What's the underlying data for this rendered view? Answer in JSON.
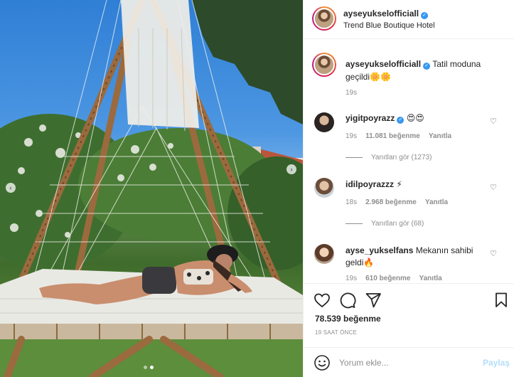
{
  "post": {
    "username": "ayseyukselofficiall",
    "location": "Trend Blue Boutique Hotel",
    "caption_username": "ayseyukselofficiall",
    "caption_text": "Tatil moduna geçildi🌼🌼",
    "caption_time": "19s",
    "likes": "78.539 beğenme",
    "time_ago": "19 SAAT ÖNCE",
    "carousel": {
      "slide_count": 2,
      "active_slide": 2
    }
  },
  "comments": [
    {
      "username": "yigitpoyrazz",
      "verified": true,
      "text": "😍😍",
      "time": "19s",
      "likes": "11.081 beğenme",
      "reply_label": "Yanıtla",
      "view_replies": "Yanıtları gör (1273)"
    },
    {
      "username": "idilpoyrazzz",
      "verified": false,
      "text": "⚡",
      "time": "18s",
      "likes": "2.968 beğenme",
      "reply_label": "Yanıtla",
      "view_replies": "Yanıtları gör (68)"
    },
    {
      "username": "ayse_yukselfans",
      "verified": false,
      "text": "Mekanın sahibi geldi🔥",
      "time": "19s",
      "likes": "610 beğenme",
      "reply_label": "Yanıtla"
    }
  ],
  "add_comment": {
    "placeholder": "Yorum ekle...",
    "post_label": "Paylaş"
  },
  "icons": {
    "like": "heart-icon",
    "comment": "comment-icon",
    "share": "share-icon",
    "save": "bookmark-icon",
    "emoji": "smiley-icon",
    "verified": "verified-badge-icon",
    "nav_prev": "chevron-left-icon",
    "nav_next": "chevron-right-icon"
  },
  "colors": {
    "verified": "#3897f0",
    "post_button_disabled": "#b2dffc",
    "muted_text": "#8e8e8e"
  }
}
